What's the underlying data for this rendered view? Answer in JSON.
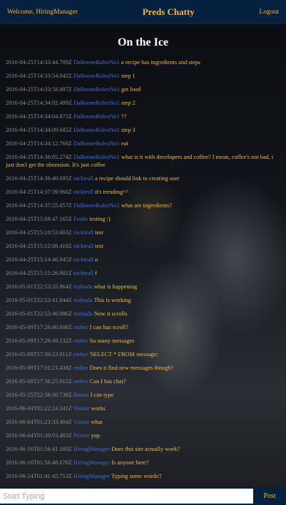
{
  "header": {
    "welcome": "Welcome, HiringManager",
    "brand": "Preds Chatty",
    "logout": "Logout"
  },
  "room": {
    "title": "On the Ice"
  },
  "messages": [
    {
      "ts": "2016-04-25T14:33:44.709Z",
      "user": "DaBooneRulezNo1",
      "text": "a recipe has ingredients and steps"
    },
    {
      "ts": "2016-04-25T14:33:54.042Z",
      "user": "DaBooneRulezNo1",
      "text": "step 1"
    },
    {
      "ts": "2016-04-25T14:33:58.097Z",
      "user": "DaBooneRulezNo1",
      "text": "get food"
    },
    {
      "ts": "2016-04-25T14:34:02.499Z",
      "user": "DaBooneRulezNo1",
      "text": "step 2"
    },
    {
      "ts": "2016-04-25T14:34:04.875Z",
      "user": "DaBooneRulezNo1",
      "text": "??"
    },
    {
      "ts": "2016-04-25T14:34:09.685Z",
      "user": "DaBooneRulezNo1",
      "text": "step 3"
    },
    {
      "ts": "2016-04-25T14:34:12.768Z",
      "user": "DaBooneRulezNo1",
      "text": "eat"
    },
    {
      "ts": "2016-04-25T14:36:05.274Z",
      "user": "DaBooneRulezNo1",
      "text": "what is it with developers and coffee? I mean, coffee's not bad, i just don't get the obsession. It's just coffee"
    },
    {
      "ts": "2016-04-25T14:36:40.695Z",
      "user": "nicktrull",
      "text": "a recipe should link to creating user"
    },
    {
      "ts": "2016-04-25T14:37:39.960Z",
      "user": "nicktrull",
      "text": "it's trending^^"
    },
    {
      "ts": "2016-04-25T14:37:55.057Z",
      "user": "DaBooneRulezNo1",
      "text": "what are ingredients?"
    },
    {
      "ts": "2016-04-25T15:08:47.165Z",
      "user": "Fooks",
      "text": "testing :)"
    },
    {
      "ts": "2016-04-25T15:10:53.603Z",
      "user": "nicktrull",
      "text": "test"
    },
    {
      "ts": "2016-04-25T15:12:08.418Z",
      "user": "nicktrull",
      "text": "test"
    },
    {
      "ts": "2016-04-25T15:14:46.945Z",
      "user": "nicktrull",
      "text": "n"
    },
    {
      "ts": "2016-04-25T15:15:26.901Z",
      "user": "nicktrull",
      "text": "f"
    },
    {
      "ts": "2016-05-01T22:53:35.864Z",
      "user": "rtabiada",
      "text": "what is happening"
    },
    {
      "ts": "2016-05-01T22:53:41.844Z",
      "user": "rtabiada",
      "text": "This is working"
    },
    {
      "ts": "2016-05-01T22:53:46.986Z",
      "user": "rtabiada",
      "text": "Now it scrolls"
    },
    {
      "ts": "2016-05-09T17:26:40.606Z",
      "user": "ember",
      "text": "I can haz scroll?"
    },
    {
      "ts": "2016-05-09T17:29:49.232Z",
      "user": "ember",
      "text": "So many messages"
    },
    {
      "ts": "2016-05-09T17:30:23.911Z",
      "user": "ember",
      "text": "'SELECT * FROM message;"
    },
    {
      "ts": "2016-05-09T17:31:21.438Z",
      "user": "ember",
      "text": "Does it find new messages though?"
    },
    {
      "ts": "2016-05-09T17:36:25.915Z",
      "user": "ember",
      "text": "Can I has chat?"
    },
    {
      "ts": "2016-05-25T22:56:30.736Z",
      "user": "Boone",
      "text": "I can type"
    },
    {
      "ts": "2016-06-04T01:22:24.341Z",
      "user": "Visitor",
      "text": "works"
    },
    {
      "ts": "2016-06-04T01:23:33.404Z",
      "user": "Visitor",
      "text": "what"
    },
    {
      "ts": "2016-06-04T01:30:03.483Z",
      "user": "Person",
      "text": "yup"
    },
    {
      "ts": "2016-06-16T01:56:41.180Z",
      "user": "HiringManager",
      "text": "Does this site actually work?"
    },
    {
      "ts": "2016-06-16T01:56:48.676Z",
      "user": "HiringManager",
      "text": "Is anyone here?"
    },
    {
      "ts": "2016-06-24T01:41:45.753Z",
      "user": "HiringManager",
      "text": "Typing some words!!"
    }
  ],
  "composer": {
    "placeholder": "Start Typing",
    "value": "",
    "post_label": "Post"
  },
  "colors": {
    "header_bg": "#06213f",
    "accent": "#f2b84a",
    "username": "#3e6fd6",
    "timestamp": "#8a8f99",
    "title": "#ffffff"
  }
}
